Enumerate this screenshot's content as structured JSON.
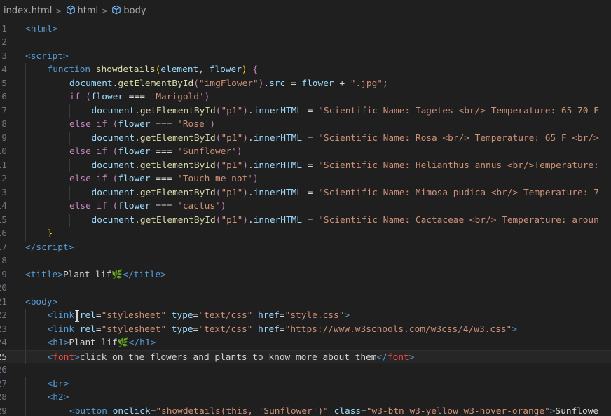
{
  "breadcrumb": {
    "file": "index.html",
    "items": [
      "html",
      "body"
    ]
  },
  "editor": {
    "current_line": 25,
    "lines": [
      {
        "n": "1",
        "indent": 0,
        "tokens": [
          [
            "t-tag",
            "<"
          ],
          [
            "t-tag",
            "html"
          ],
          [
            "t-tag",
            ">"
          ]
        ]
      },
      {
        "n": "2",
        "indent": 0,
        "tokens": []
      },
      {
        "n": "3",
        "indent": 0,
        "tokens": [
          [
            "t-tag",
            "<"
          ],
          [
            "t-tag",
            "script"
          ],
          [
            "t-tag",
            ">"
          ]
        ]
      },
      {
        "n": "4",
        "indent": 1,
        "tokens": [
          [
            "t-tag",
            "function "
          ],
          [
            "t-fn",
            "showdetails"
          ],
          [
            "t-brace",
            "("
          ],
          [
            "t-var",
            "element"
          ],
          [
            "t-op",
            ", "
          ],
          [
            "t-var",
            "flower"
          ],
          [
            "t-brace",
            ")"
          ],
          [
            "t-op",
            " "
          ],
          [
            "t-kw",
            "{"
          ]
        ]
      },
      {
        "n": "5",
        "indent": 2,
        "tokens": [
          [
            "t-var",
            "document"
          ],
          [
            "t-op",
            "."
          ],
          [
            "t-fn",
            "getElementById"
          ],
          [
            "t-kw",
            "("
          ],
          [
            "t-str",
            "\"imgFlower\""
          ],
          [
            "t-kw",
            ")"
          ],
          [
            "t-op",
            "."
          ],
          [
            "t-var",
            "src"
          ],
          [
            "t-op",
            " = "
          ],
          [
            "t-var",
            "flower"
          ],
          [
            "t-op",
            " + "
          ],
          [
            "t-str",
            "\".jpg\""
          ],
          [
            "t-op",
            ";"
          ]
        ]
      },
      {
        "n": "6",
        "indent": 2,
        "tokens": [
          [
            "t-kw",
            "if "
          ],
          [
            "t-kw",
            "("
          ],
          [
            "t-var",
            "flower"
          ],
          [
            "t-op",
            " === "
          ],
          [
            "t-str",
            "'Marigold'"
          ],
          [
            "t-kw",
            ")"
          ]
        ]
      },
      {
        "n": "7",
        "indent": 3,
        "tokens": [
          [
            "t-var",
            "document"
          ],
          [
            "t-op",
            "."
          ],
          [
            "t-fn",
            "getElementById"
          ],
          [
            "t-kw",
            "("
          ],
          [
            "t-str",
            "\"p1\""
          ],
          [
            "t-kw",
            ")"
          ],
          [
            "t-op",
            "."
          ],
          [
            "t-var",
            "innerHTML"
          ],
          [
            "t-op",
            " = "
          ],
          [
            "t-str",
            "\"Scientific Name: Tagetes <br/> Temperature: 65-70 F"
          ]
        ]
      },
      {
        "n": "8",
        "indent": 2,
        "tokens": [
          [
            "t-kw",
            "else if "
          ],
          [
            "t-kw",
            "("
          ],
          [
            "t-var",
            "flower"
          ],
          [
            "t-op",
            " === "
          ],
          [
            "t-str",
            "'Rose'"
          ],
          [
            "t-kw",
            ")"
          ]
        ]
      },
      {
        "n": "9",
        "indent": 3,
        "tokens": [
          [
            "t-var",
            "document"
          ],
          [
            "t-op",
            "."
          ],
          [
            "t-fn",
            "getElementById"
          ],
          [
            "t-kw",
            "("
          ],
          [
            "t-str",
            "\"p1\""
          ],
          [
            "t-kw",
            ")"
          ],
          [
            "t-op",
            "."
          ],
          [
            "t-var",
            "innerHTML"
          ],
          [
            "t-op",
            " = "
          ],
          [
            "t-str",
            "\"Scientific Name: Rosa <br/> Temperature: 65 F <br/>"
          ]
        ]
      },
      {
        "n": "10",
        "indent": 2,
        "tokens": [
          [
            "t-kw",
            "else if "
          ],
          [
            "t-kw",
            "("
          ],
          [
            "t-var",
            "flower"
          ],
          [
            "t-op",
            " === "
          ],
          [
            "t-str",
            "'Sunflower'"
          ],
          [
            "t-kw",
            ")"
          ]
        ]
      },
      {
        "n": "11",
        "indent": 3,
        "tokens": [
          [
            "t-var",
            "document"
          ],
          [
            "t-op",
            "."
          ],
          [
            "t-fn",
            "getElementById"
          ],
          [
            "t-kw",
            "("
          ],
          [
            "t-str",
            "\"p1\""
          ],
          [
            "t-kw",
            ")"
          ],
          [
            "t-op",
            "."
          ],
          [
            "t-var",
            "innerHTML"
          ],
          [
            "t-op",
            " = "
          ],
          [
            "t-str",
            "\"Scientific Name: Helianthus annus <br/>Temperature:"
          ]
        ]
      },
      {
        "n": "12",
        "indent": 2,
        "tokens": [
          [
            "t-kw",
            "else if "
          ],
          [
            "t-kw",
            "("
          ],
          [
            "t-var",
            "flower"
          ],
          [
            "t-op",
            " === "
          ],
          [
            "t-str",
            "'Touch me not'"
          ],
          [
            "t-kw",
            ")"
          ]
        ]
      },
      {
        "n": "13",
        "indent": 3,
        "tokens": [
          [
            "t-var",
            "document"
          ],
          [
            "t-op",
            "."
          ],
          [
            "t-fn",
            "getElementById"
          ],
          [
            "t-kw",
            "("
          ],
          [
            "t-str",
            "\"p1\""
          ],
          [
            "t-kw",
            ")"
          ],
          [
            "t-op",
            "."
          ],
          [
            "t-var",
            "innerHTML"
          ],
          [
            "t-op",
            " = "
          ],
          [
            "t-str",
            "\"Scientific Name: Mimosa pudica <br/> Temperature: 7"
          ]
        ]
      },
      {
        "n": "14",
        "indent": 2,
        "tokens": [
          [
            "t-kw",
            "else if "
          ],
          [
            "t-kw",
            "("
          ],
          [
            "t-var",
            "flower"
          ],
          [
            "t-op",
            " === "
          ],
          [
            "t-str",
            "'cactus'"
          ],
          [
            "t-kw",
            ")"
          ]
        ]
      },
      {
        "n": "15",
        "indent": 3,
        "tokens": [
          [
            "t-var",
            "document"
          ],
          [
            "t-op",
            "."
          ],
          [
            "t-fn",
            "getElementById"
          ],
          [
            "t-kw",
            "("
          ],
          [
            "t-str",
            "\"p1\""
          ],
          [
            "t-kw",
            ")"
          ],
          [
            "t-op",
            "."
          ],
          [
            "t-var",
            "innerHTML"
          ],
          [
            "t-op",
            " = "
          ],
          [
            "t-str",
            "\"Scientific Name: Cactaceae <br/> Temperature: aroun"
          ]
        ]
      },
      {
        "n": "16",
        "indent": 1,
        "tokens": [
          [
            "t-brace",
            "}"
          ]
        ]
      },
      {
        "n": "17",
        "indent": 0,
        "tokens": [
          [
            "t-tag",
            "</"
          ],
          [
            "t-tag",
            "script"
          ],
          [
            "t-tag",
            ">"
          ]
        ]
      },
      {
        "n": "18",
        "indent": 0,
        "tokens": []
      },
      {
        "n": "19",
        "indent": 0,
        "tokens": [
          [
            "t-tag",
            "<"
          ],
          [
            "t-tag",
            "title"
          ],
          [
            "t-tag",
            ">"
          ],
          [
            "t-text",
            "Plant lif🌿"
          ],
          [
            "t-tag",
            "</"
          ],
          [
            "t-tag",
            "title"
          ],
          [
            "t-tag",
            ">"
          ]
        ]
      },
      {
        "n": "20",
        "indent": 0,
        "tokens": []
      },
      {
        "n": "21",
        "indent": 0,
        "tokens": [
          [
            "t-tag",
            "<"
          ],
          [
            "t-tag",
            "body"
          ],
          [
            "t-tag",
            ">"
          ]
        ]
      },
      {
        "n": "22",
        "indent": 1,
        "tokens": [
          [
            "t-tag",
            "<"
          ],
          [
            "t-tag",
            "link "
          ],
          [
            "t-attr",
            "rel"
          ],
          [
            "t-op",
            "="
          ],
          [
            "t-str",
            "\"stylesheet\""
          ],
          [
            "t-op",
            " "
          ],
          [
            "t-attr",
            "type"
          ],
          [
            "t-op",
            "="
          ],
          [
            "t-str",
            "\"text/css\""
          ],
          [
            "t-op",
            " "
          ],
          [
            "t-attr",
            "href"
          ],
          [
            "t-op",
            "="
          ],
          [
            "t-str",
            "\""
          ],
          [
            "t-link",
            "style.css"
          ],
          [
            "t-str",
            "\""
          ],
          [
            "t-tag",
            ">"
          ]
        ]
      },
      {
        "n": "23",
        "indent": 1,
        "tokens": [
          [
            "t-tag",
            "<"
          ],
          [
            "t-tag",
            "link "
          ],
          [
            "t-attr",
            "rel"
          ],
          [
            "t-op",
            "="
          ],
          [
            "t-str",
            "\"stylesheet\""
          ],
          [
            "t-op",
            " "
          ],
          [
            "t-attr",
            "type"
          ],
          [
            "t-op",
            "="
          ],
          [
            "t-str",
            "\"text/css\""
          ],
          [
            "t-op",
            " "
          ],
          [
            "t-attr",
            "href"
          ],
          [
            "t-op",
            "="
          ],
          [
            "t-str",
            "\""
          ],
          [
            "t-link",
            "https://www.w3schools.com/w3css/4/w3.css"
          ],
          [
            "t-str",
            "\""
          ],
          [
            "t-tag",
            ">"
          ]
        ]
      },
      {
        "n": "24",
        "indent": 1,
        "tokens": [
          [
            "t-tag",
            "<"
          ],
          [
            "t-tag",
            "h1"
          ],
          [
            "t-tag",
            ">"
          ],
          [
            "t-text",
            "Plant lif🌿"
          ],
          [
            "t-tag",
            "</"
          ],
          [
            "t-tag",
            "h1"
          ],
          [
            "t-tag",
            ">"
          ]
        ]
      },
      {
        "n": "25",
        "indent": 1,
        "tokens": [
          [
            "t-tag",
            "<"
          ],
          [
            "t-red",
            "font"
          ],
          [
            "t-tag",
            ">"
          ],
          [
            "t-text",
            "click on the flowers and plants to know more about them"
          ],
          [
            "t-tag",
            "</"
          ],
          [
            "t-red",
            "font"
          ],
          [
            "t-tag",
            ">"
          ]
        ]
      },
      {
        "n": "26",
        "indent": 0,
        "tokens": []
      },
      {
        "n": "27",
        "indent": 1,
        "tokens": [
          [
            "t-tag",
            "<"
          ],
          [
            "t-tag",
            "br"
          ],
          [
            "t-tag",
            ">"
          ]
        ]
      },
      {
        "n": "28",
        "indent": 1,
        "tokens": [
          [
            "t-tag",
            "<"
          ],
          [
            "t-tag",
            "h2"
          ],
          [
            "t-tag",
            ">"
          ]
        ]
      },
      {
        "n": "29",
        "indent": 2,
        "tokens": [
          [
            "t-tag",
            "<"
          ],
          [
            "t-tag",
            "button "
          ],
          [
            "t-attr",
            "onclick"
          ],
          [
            "t-op",
            "="
          ],
          [
            "t-str",
            "\"showdetails(this, 'Sunflower')\""
          ],
          [
            "t-op",
            " "
          ],
          [
            "t-attr",
            "class"
          ],
          [
            "t-op",
            "="
          ],
          [
            "t-str",
            "\"w3-btn w3-yellow w3-hover-orange\""
          ],
          [
            "t-tag",
            ">"
          ],
          [
            "t-text",
            "Sunflowe"
          ]
        ]
      }
    ]
  }
}
